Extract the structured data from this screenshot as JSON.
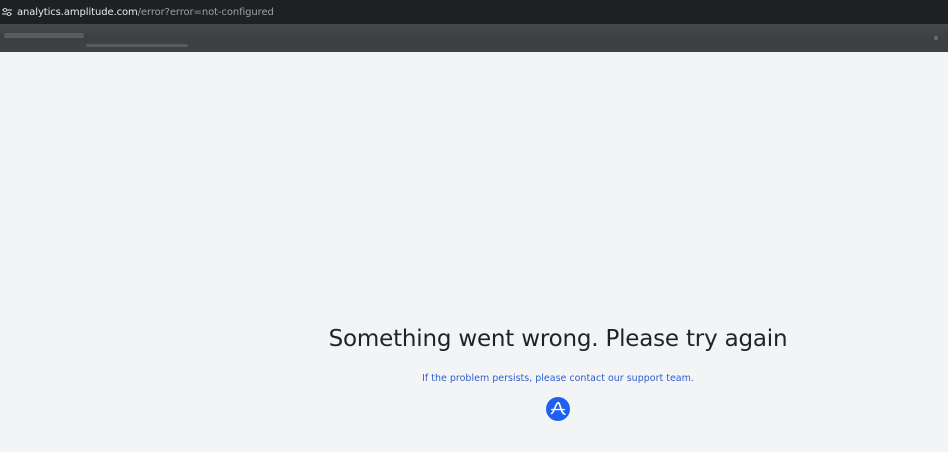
{
  "browser": {
    "url_host": "analytics.amplitude.com",
    "url_path": "/error?error=not-configured",
    "site_info_icon": "tune-icon"
  },
  "page": {
    "heading": "Something went wrong. Please try again",
    "support_text": "If the problem persists, please contact our support team.",
    "logo_icon": "amplitude-logo"
  },
  "colors": {
    "page_background": "#f3f4f6",
    "heading": "#1f2328",
    "link": "#2f5fd0",
    "logo": "#1e61f0"
  }
}
